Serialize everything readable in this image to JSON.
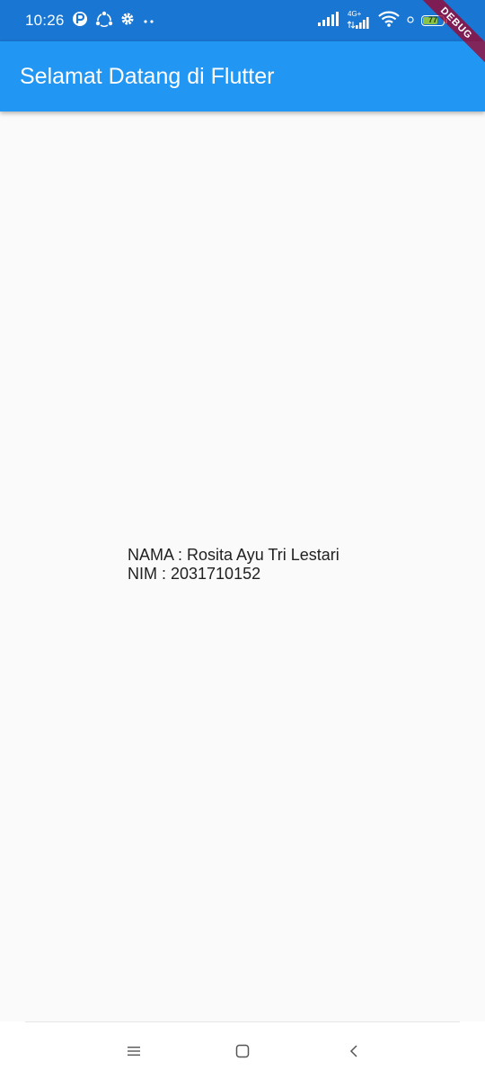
{
  "status_bar": {
    "time": "10:26",
    "network_label": "4G+",
    "battery_level": "77",
    "battery_percent": 77
  },
  "debug_banner": {
    "label": "DEBUG"
  },
  "app_bar": {
    "title": "Selamat Datang di Flutter"
  },
  "content": {
    "name_line": "NAMA : Rosita Ayu Tri Lestari",
    "nim_line": "NIM : 2031710152"
  },
  "nav_bar": {
    "icons": [
      "menu-icon",
      "home-icon",
      "back-icon"
    ]
  },
  "colors": {
    "status_bar": "#1976d2",
    "app_bar": "#2196f3",
    "background": "#fafafa",
    "text": "#212121",
    "debug_ribbon": "#a00028",
    "battery_fill": "#8bc34a"
  }
}
